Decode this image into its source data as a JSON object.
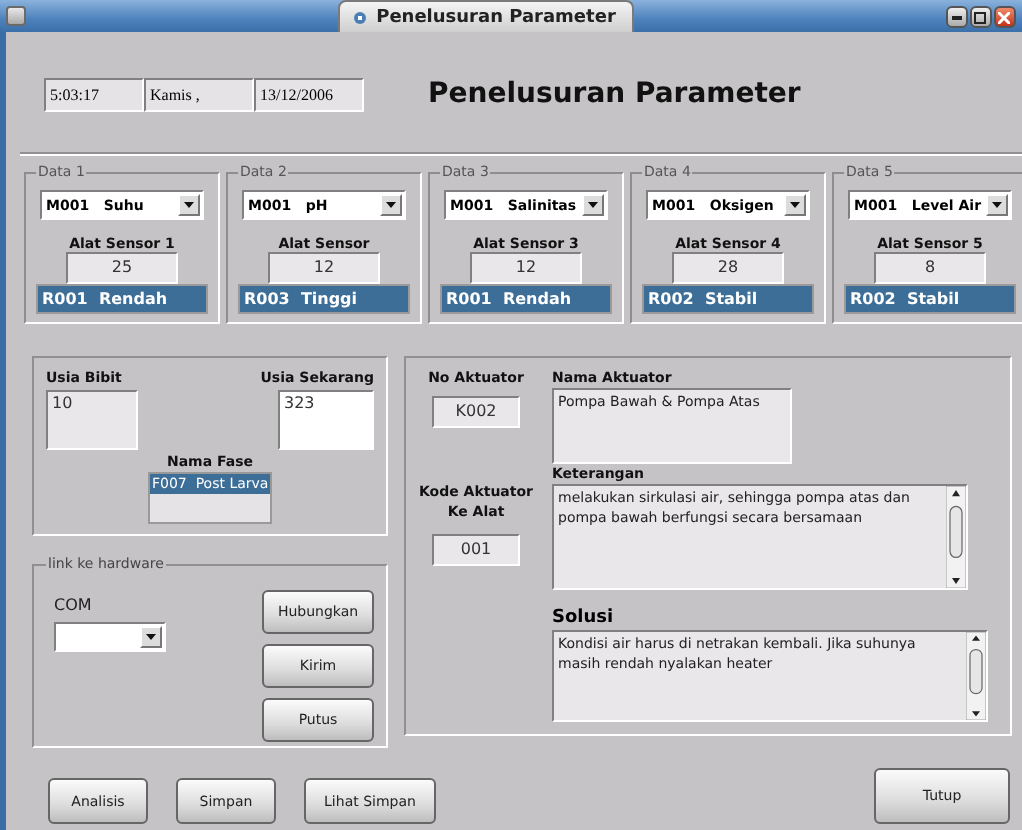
{
  "window": {
    "title": "Penelusuran Parameter"
  },
  "header": {
    "time": "5:03:17",
    "day": "Kamis ,",
    "date": "13/12/2006",
    "title": "Penelusuran Parameter"
  },
  "sensors": [
    {
      "group": "Data 1",
      "module": "M001",
      "parameter": "Suhu",
      "label": "Alat Sensor 1",
      "value": "25",
      "result_code": "R001",
      "result": "Rendah",
      "selected": true
    },
    {
      "group": "Data 2",
      "module": "M001",
      "parameter": "pH",
      "label": "Alat Sensor",
      "value": "12",
      "result_code": "R003",
      "result": "Tinggi",
      "selected": true
    },
    {
      "group": "Data 3",
      "module": "M001",
      "parameter": "Salinitas",
      "label": "Alat Sensor 3",
      "value": "12",
      "result_code": "R001",
      "result": "Rendah",
      "selected": true
    },
    {
      "group": "Data 4",
      "module": "M001",
      "parameter": "Oksigen",
      "label": "Alat Sensor 4",
      "value": "28",
      "result_code": "R002",
      "result": "Stabil",
      "selected": true
    },
    {
      "group": "Data 5",
      "module": "M001",
      "parameter": "Level Air",
      "label": "Alat Sensor 5",
      "value": "8",
      "result_code": "R002",
      "result": "Stabil",
      "selected": true
    }
  ],
  "usia": {
    "bibit_label": "Usia Bibit",
    "bibit": "10",
    "sekarang_label": "Usia Sekarang",
    "sekarang": "323",
    "fase_label": "Nama Fase",
    "fase": "F007  Post Larva",
    "fase_selected": true
  },
  "hardware": {
    "group": "link ke hardware",
    "port_label": "COM",
    "buttons": [
      "Hubungkan",
      "Kirim",
      "Putus"
    ]
  },
  "actuator": {
    "no_label": "No Aktuator",
    "no": "K002",
    "kode_label": "Kode Aktuator Ke Alat",
    "kode": "001",
    "nama_label": "Nama Aktuator",
    "nama": "Pompa Bawah & Pompa Atas",
    "keterangan_label": "Keterangan",
    "keterangan": "melakukan sirkulasi air, sehingga pompa atas dan pompa bawah berfungsi secara bersamaan",
    "solusi_label": "Solusi",
    "solusi": "Kondisi air harus di netrakan kembali. Jika suhunya masih rendah nyalakan heater"
  },
  "buttons": [
    "Analisis",
    "Simpan",
    "Lihat Simpan"
  ],
  "close": "Tutup"
}
